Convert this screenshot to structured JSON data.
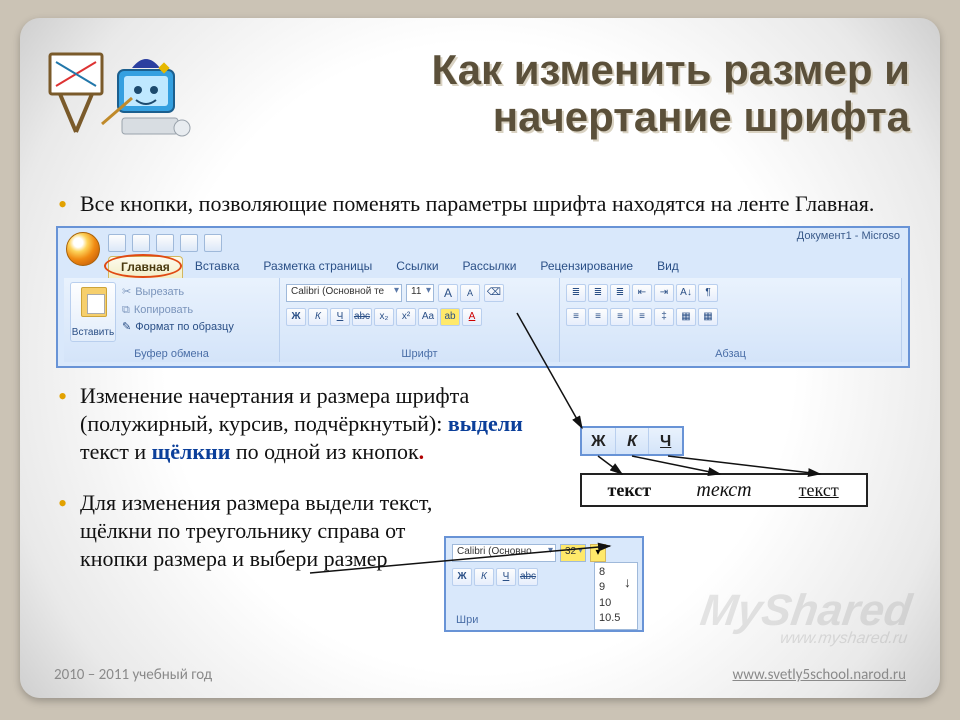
{
  "title": "Как изменить размер и начертание шрифта",
  "bullets": {
    "b1": "Все кнопки, позволяющие поменять параметры шрифта находятся на ленте Главная.",
    "b2_a": "Изменение начертания  и размера шрифта (полужирный, курсив, подчёркнутый): ",
    "b2_bold1": "выдели",
    "b2_mid": " текст и ",
    "b2_bold2": "щёлкни",
    "b2_end": " по одной из кнопок",
    "b2_dot": ".",
    "b3": "Для изменения размера выдели текст, щёлкни по треугольнику справа от кнопки размера  и выбери размер"
  },
  "ribbon": {
    "doc_title": "Документ1 - Microso",
    "tabs": [
      "Главная",
      "Вставка",
      "Разметка страницы",
      "Ссылки",
      "Рассылки",
      "Рецензирование",
      "Вид"
    ],
    "paste": "Вставить",
    "clip_cut": "Вырезать",
    "clip_copy": "Копировать",
    "clip_format": "Формат по образцу",
    "grp_clip": "Буфер обмена",
    "grp_font": "Шрифт",
    "grp_para": "Абзац",
    "font_family": "Calibri (Основной те",
    "font_size": "11",
    "bold": "Ж",
    "italic": "К",
    "underline": "Ч",
    "strike": "abc",
    "sub": "x₂",
    "sup": "x²",
    "case": "Aa",
    "grow": "A",
    "shrink": "A",
    "hilite": "ab",
    "fcolor": "A"
  },
  "mini_biu": {
    "b": "Ж",
    "i": "К",
    "u": "Ч"
  },
  "samples": {
    "bold": "текст",
    "ital": "текст",
    "und": "текст"
  },
  "mini_size": {
    "family": "Calibri (Основно",
    "size": "32",
    "cap": "Шри",
    "options": [
      "8",
      "9",
      "10",
      "10.5"
    ]
  },
  "footer": {
    "left": "2010 – 2011 учебный год",
    "right": "www.svetly5school.narod.ru"
  },
  "watermark": {
    "big": "MyShared",
    "small": "www.myshared.ru"
  }
}
